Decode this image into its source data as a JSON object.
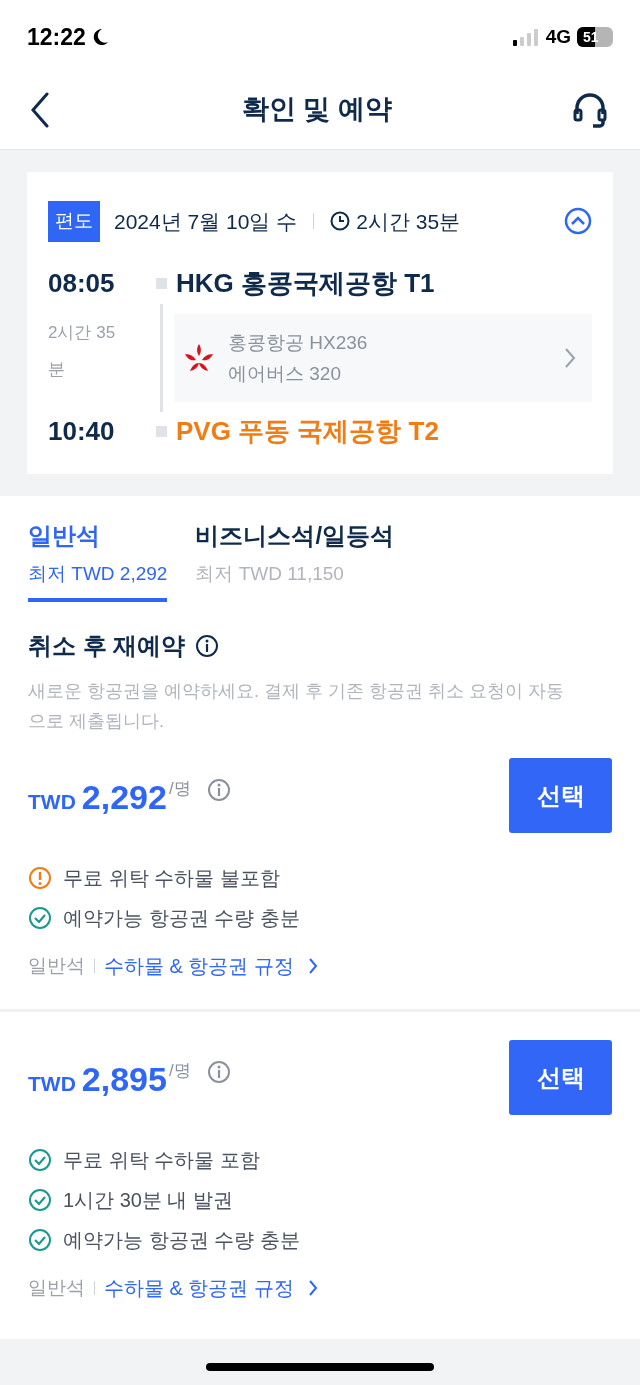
{
  "status_bar": {
    "time": "12:22",
    "network": "4G",
    "battery": "51"
  },
  "header": {
    "title": "확인 및 예약"
  },
  "flight": {
    "tag": "편도",
    "date": "2024년 7월 10일 수",
    "duration": "2시간 35분",
    "expanded": true,
    "departure": {
      "time": "08:05",
      "airport": "HKG 홍콩국제공항 T1"
    },
    "travel_time": "2시간 35\n분",
    "airline": "홍콩항공 HX236",
    "aircraft": "에어버스 320",
    "arrival": {
      "time": "10:40",
      "airport": "PVG 푸동 국제공항 T2"
    }
  },
  "tabs": [
    {
      "label": "일반석",
      "price": "최저 TWD 2,292",
      "selected": true
    },
    {
      "label": "비즈니스석/일등석",
      "price": "최저 TWD 11,150",
      "selected": false
    }
  ],
  "section": {
    "title": "취소 후 재예약",
    "description": "새로운 항공권을 예약하세요.  결제 후 기존 항공권 취소 요청이 자동으로 제출됩니다."
  },
  "offers": [
    {
      "currency": "TWD",
      "price": "2,292",
      "unit": "/명",
      "button": "선택",
      "features": [
        {
          "kind": "warning",
          "text": "무료 위탁 수하물 불포함"
        },
        {
          "kind": "ok",
          "text": "예약가능 항공권 수량 충분"
        }
      ],
      "cabin": "일반석",
      "rules_link": "수하물 & 항공권 규정"
    },
    {
      "currency": "TWD",
      "price": "2,895",
      "unit": "/명",
      "button": "선택",
      "features": [
        {
          "kind": "ok",
          "text": "무료 위탁 수하물 포함"
        },
        {
          "kind": "ok",
          "text": "1시간 30분 내 발권"
        },
        {
          "kind": "ok",
          "text": "예약가능 항공권 수량 충분"
        }
      ],
      "cabin": "일반석",
      "rules_link": "수하물 & 항공권 규정"
    }
  ]
}
